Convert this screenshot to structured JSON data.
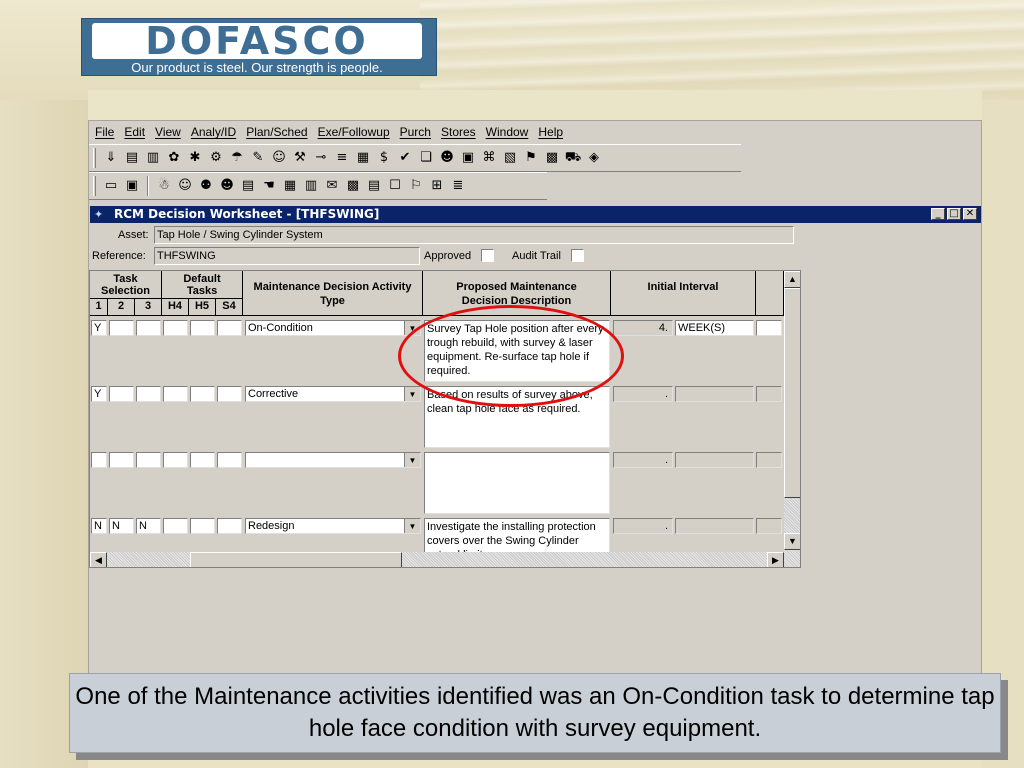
{
  "logo": {
    "wordmark": "DOFASCO",
    "tagline": "Our product is steel. Our strength is people."
  },
  "menu": [
    "File",
    "Edit",
    "View",
    "Analy/ID",
    "Plan/Sched",
    "Exe/Followup",
    "Purch",
    "Stores",
    "Window",
    "Help"
  ],
  "toolbar1_icons": [
    "page-icon",
    "folder-icon",
    "chart-icon",
    "tools-icon",
    "gear-icon",
    "cog-icon",
    "lamp-icon",
    "wrench-icon",
    "clock-icon",
    "tree-icon",
    "key-icon",
    "list-icon",
    "note-icon",
    "dollar-icon",
    "check-icon",
    "dish-icon",
    "smile-icon",
    "document-icon",
    "flow-icon",
    "box-icon",
    "flag-icon",
    "receive-icon",
    "vehicle-icon",
    "money-icon"
  ],
  "toolbar1_glyphs": [
    "⇓",
    "▤",
    "▥",
    "✿",
    "✱",
    "⚙",
    "☂",
    "✎",
    "☺",
    "⚒",
    "⊸",
    "≡",
    "▦",
    "$",
    "✔",
    "❏",
    "☻",
    "▣",
    "⌘",
    "▧",
    "⚑",
    "▩",
    "⛟",
    "◈"
  ],
  "toolbar2_icons": [
    "new-icon",
    "save-icon",
    "people-icon",
    "group-icon",
    "worker-icon",
    "person-icon",
    "report-icon",
    "hand-icon",
    "table-icon",
    "grid-icon",
    "stamp-icon",
    "cards-icon",
    "form-icon",
    "book-icon",
    "chart2-icon",
    "cube-icon",
    "bars-icon"
  ],
  "toolbar2_glyphs": [
    "▭",
    "▣",
    "☃",
    "☺",
    "⚉",
    "☻",
    "▤",
    "☚",
    "▦",
    "▥",
    "✉",
    "▩",
    "▤",
    "☐",
    "⚐",
    "⊞",
    "≣"
  ],
  "window": {
    "title": "RCM Decision Worksheet - [THFSWING]",
    "asset_label": "Asset:",
    "asset_value": "Tap Hole / Swing Cylinder System",
    "reference_label": "Reference:",
    "reference_value": "THFSWING",
    "approved_label": "Approved",
    "audit_label": "Audit Trail"
  },
  "grid": {
    "task_header_top": "Task",
    "task_header_mid": "Selection",
    "default_header_top": "Default",
    "default_header_mid": "Tasks",
    "sub_headers": [
      "1",
      "2",
      "3",
      "H4",
      "H5",
      "S4"
    ],
    "activity_header": "Maintenance Decision Activity Type",
    "proposal_header": "Proposed Maintenance Decision Description",
    "interval_header": "Initial Interval",
    "rows": [
      {
        "flags": [
          "Y",
          "",
          "",
          "",
          "",
          ""
        ],
        "activity": "On-Condition",
        "description": "Survey Tap Hole position after every trough rebuild, with survey & laser equipment. Re-surface tap hole if required.",
        "interval_num": "4.",
        "interval_unit": "WEEK(S) [Time]"
      },
      {
        "flags": [
          "Y",
          "",
          "",
          "",
          "",
          ""
        ],
        "activity": "Corrective",
        "description": "Based on results of survey above, clean tap hole face as required.",
        "interval_num": ".",
        "interval_unit": ""
      },
      {
        "flags": [
          "",
          "",
          "",
          "",
          "",
          ""
        ],
        "activity": "",
        "description": "",
        "interval_num": ".",
        "interval_unit": ""
      },
      {
        "flags": [
          "N",
          "N",
          "N",
          "",
          "",
          ""
        ],
        "activity": "Redesign",
        "description": "Investigate the installing protection covers over the Swing Cylinder extend limit.",
        "interval_num": ".",
        "interval_unit": ""
      }
    ]
  },
  "caption": "One of the Maintenance activities identified was an On-Condition task to determine tap hole face condition with survey equipment.",
  "colors": {
    "titlebar": "#0a246a",
    "annotation": "#e01010",
    "logo_blue": "#3f6e95",
    "caption_bg": "#c9cfd7"
  }
}
